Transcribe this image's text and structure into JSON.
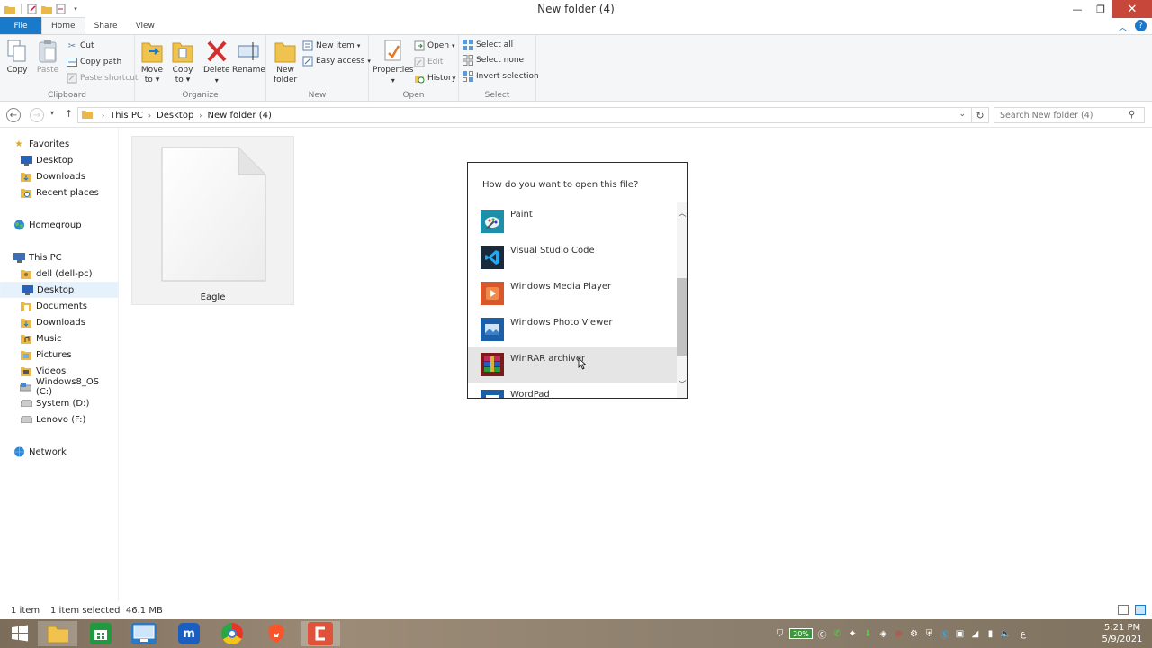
{
  "window": {
    "title": "New folder (4)",
    "controls": {
      "minimize": "—",
      "maximize": "❐",
      "close": "✕"
    }
  },
  "tabs": [
    "File",
    "Home",
    "Share",
    "View"
  ],
  "ribbon": {
    "clipboard": {
      "label": "Clipboard",
      "copy": "Copy",
      "paste": "Paste",
      "cut": "Cut",
      "copy_path": "Copy path",
      "paste_shortcut": "Paste shortcut"
    },
    "organize": {
      "label": "Organize",
      "move_to_1": "Move",
      "move_to_2": "to",
      "copy_to_1": "Copy",
      "copy_to_2": "to",
      "delete": "Delete",
      "rename": "Rename"
    },
    "new": {
      "label": "New",
      "new_folder_1": "New",
      "new_folder_2": "folder",
      "new_item": "New item",
      "easy_access": "Easy access"
    },
    "open": {
      "label": "Open",
      "properties": "Properties",
      "open": "Open",
      "edit": "Edit",
      "history": "History"
    },
    "select": {
      "label": "Select",
      "select_all": "Select all",
      "select_none": "Select none",
      "invert_selection": "Invert selection"
    }
  },
  "address": {
    "crumbs": [
      "This PC",
      "Desktop",
      "New folder (4)"
    ],
    "search_placeholder": "Search New folder (4)"
  },
  "nav": {
    "favorites": "Favorites",
    "fav_items": [
      "Desktop",
      "Downloads",
      "Recent places"
    ],
    "homegroup": "Homegroup",
    "this_pc": "This PC",
    "pc_items": [
      "dell (dell-pc)",
      "Desktop",
      "Documents",
      "Downloads",
      "Music",
      "Pictures",
      "Videos",
      "Windows8_OS (C:)",
      "System (D:)",
      "Lenovo (F:)"
    ],
    "network": "Network"
  },
  "file": {
    "name": "Eagle"
  },
  "dialog": {
    "title": "How do you want to open this file?",
    "apps": [
      "Paint",
      "Visual Studio Code",
      "Windows Media Player",
      "Windows Photo Viewer",
      "WinRAR archiver",
      "WordPad"
    ]
  },
  "status": {
    "count": "1 item",
    "selected": "1 item selected  46.1 MB"
  },
  "taskbar": {
    "battery": "20%",
    "time": "5:21 PM",
    "date": "5/9/2021",
    "lang": "ع"
  },
  "colors": {
    "accent": "#1979ca",
    "close": "#c7473a",
    "selection": "#e5f1fb"
  }
}
